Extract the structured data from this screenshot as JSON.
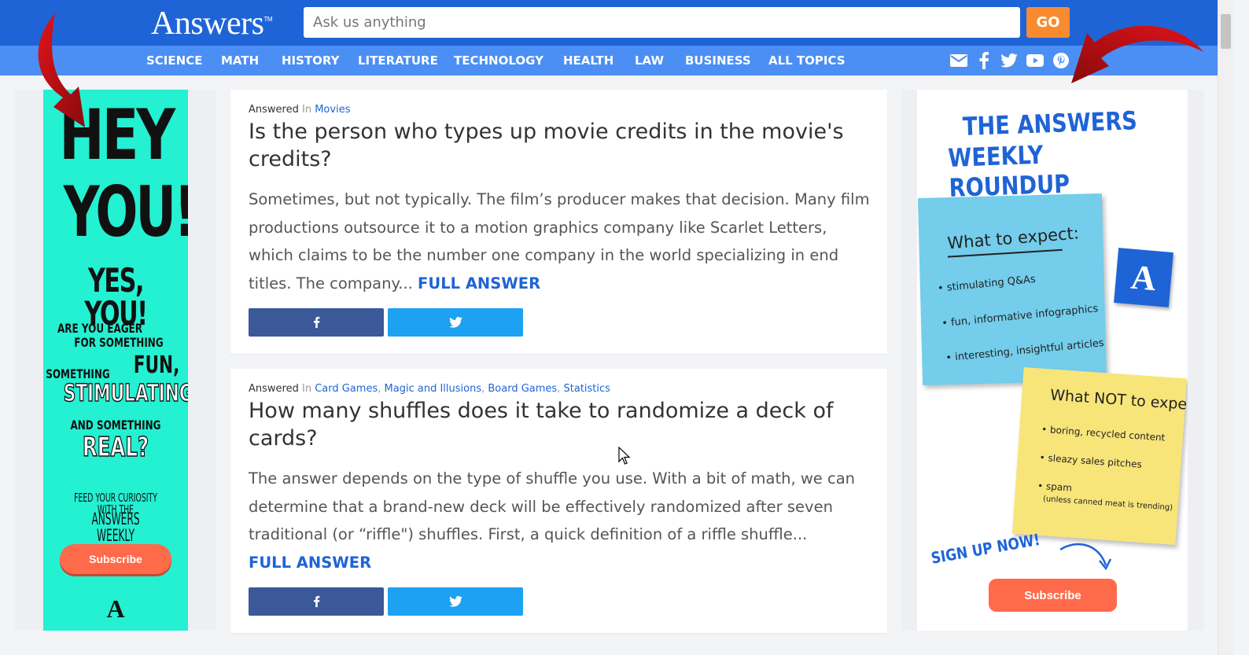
{
  "header": {
    "logo": "Answers",
    "logo_tm": "TM",
    "search_placeholder": "Ask us anything",
    "go_label": "GO"
  },
  "nav": [
    "SCIENCE",
    "MATH",
    "HISTORY",
    "LITERATURE",
    "TECHNOLOGY",
    "HEALTH",
    "LAW",
    "BUSINESS",
    "ALL TOPICS"
  ],
  "social_icons": [
    "email-icon",
    "facebook-icon",
    "twitter-icon",
    "youtube-icon",
    "pinterest-icon"
  ],
  "ad_left": {
    "hey": "HEY",
    "you": "YOU!",
    "yes_you": "YES, YOU!",
    "line1": "ARE YOU EAGER",
    "line2": "FOR SOMETHING",
    "line3": "SOMETHING",
    "fun": "FUN,",
    "stimulating": "STIMULATING,",
    "line4": "AND SOMETHING",
    "real": "REAL?",
    "feed": "FEED YOUR CURIOSITY WITH THE",
    "roundup": "ANSWERS WEEKLY ROUNDUP",
    "subscribe": "Subscribe",
    "logo": "A"
  },
  "cards": [
    {
      "answered": "Answered",
      "in": "In",
      "categories": [
        "Movies"
      ],
      "title": "Is the person who types up movie credits in the movie's credits?",
      "body": "Sometimes, but not typically. The film’s producer makes that decision. Many film productions outsource it to a motion graphics company like Scarlet Letters, which claims to be the number one company in the world specializing in end titles. The company...",
      "full_answer": "FULL ANSWER"
    },
    {
      "answered": "Answered",
      "in": "In",
      "categories": [
        "Card Games",
        "Magic and Illusions",
        "Board Games",
        "Statistics"
      ],
      "title": "How many shuffles does it take to randomize a deck of cards?",
      "body": "The answer depends on the type of shuffle you use. With a bit of math, we can determine that a brand-new deck will be effectively randomized after seven traditional (or “riffle\") shuffles. First, a quick definition of a riffle shuffle...",
      "full_answer": "FULL ANSWER"
    }
  ],
  "ad_right": {
    "title1": "THE ANSWERS",
    "title2": "WEEKLY ROUNDUP",
    "expect_title": "What to expect:",
    "expect_items": [
      "stimulating Q&As",
      "fun, informative infographics",
      "interesting, insightful articles"
    ],
    "not_title": "What NOT to expect:",
    "not_items": [
      "boring, recycled content",
      "sleazy sales pitches",
      "spam",
      "(unless canned meat is trending)"
    ],
    "sign_up": "SIGN UP NOW!",
    "subscribe": "Subscribe",
    "logo": "A"
  },
  "colors": {
    "header_blue": "#1f64d6",
    "nav_blue": "#4b8ef4",
    "go_orange": "#f88b2f",
    "ad_teal": "#24f0d2",
    "subscribe_coral": "#ff6a4a",
    "facebook": "#3b5998",
    "twitter": "#1da1f2"
  }
}
